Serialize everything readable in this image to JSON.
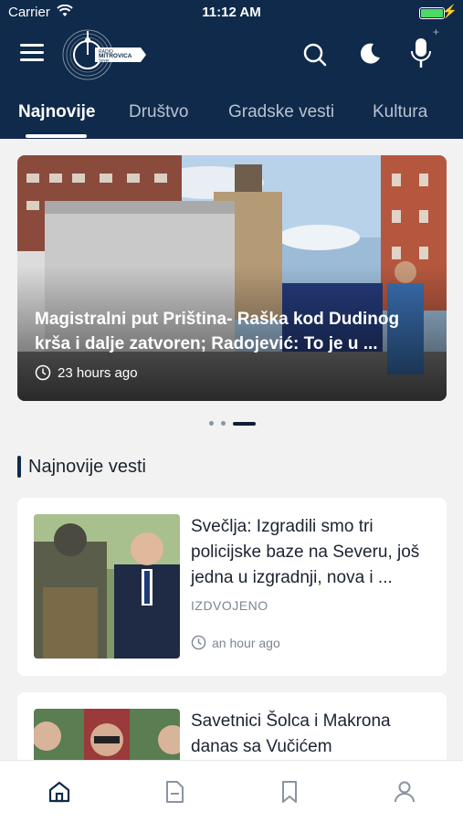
{
  "status_bar": {
    "carrier": "Carrier",
    "time": "11:12 AM"
  },
  "header": {
    "logo_text": {
      "line1": "RADIO",
      "line2": "MITROVICA",
      "line3": "Sever"
    },
    "icons": [
      "menu-icon",
      "search-icon",
      "moon-icon",
      "microphone-icon"
    ]
  },
  "tabs": [
    {
      "label": "Najnovije",
      "active": true
    },
    {
      "label": "Društvo",
      "active": false
    },
    {
      "label": "Gradske vesti",
      "active": false
    },
    {
      "label": "Kultura",
      "active": false
    }
  ],
  "hero": {
    "title": "Magistralni put Priština- Raška kod Dudinog krša i dalje zatvoren; Radojević: To je u ...",
    "time": "23 hours ago",
    "pagination": {
      "count": 3,
      "active_index": 2
    }
  },
  "section": {
    "title": "Najnovije vesti"
  },
  "articles": [
    {
      "title": "Svečlja: Izgradili smo tri policijske baze na Severu, još jedna u izgradnji, nova i ...",
      "category": "IZDVOJENO",
      "time": "an hour ago"
    },
    {
      "title": "Savetnici Šolca i Makrona danas sa Vučićem",
      "category": "",
      "time": ""
    }
  ],
  "bottom_nav": [
    {
      "icon": "home-icon",
      "active": true
    },
    {
      "icon": "document-icon",
      "active": false
    },
    {
      "icon": "bookmark-icon",
      "active": false
    },
    {
      "icon": "profile-icon",
      "active": false
    }
  ],
  "colors": {
    "header_bg": "#0f2a4a",
    "accent": "#0f2a4a",
    "battery": "#4cd964",
    "muted": "#7d8692"
  }
}
